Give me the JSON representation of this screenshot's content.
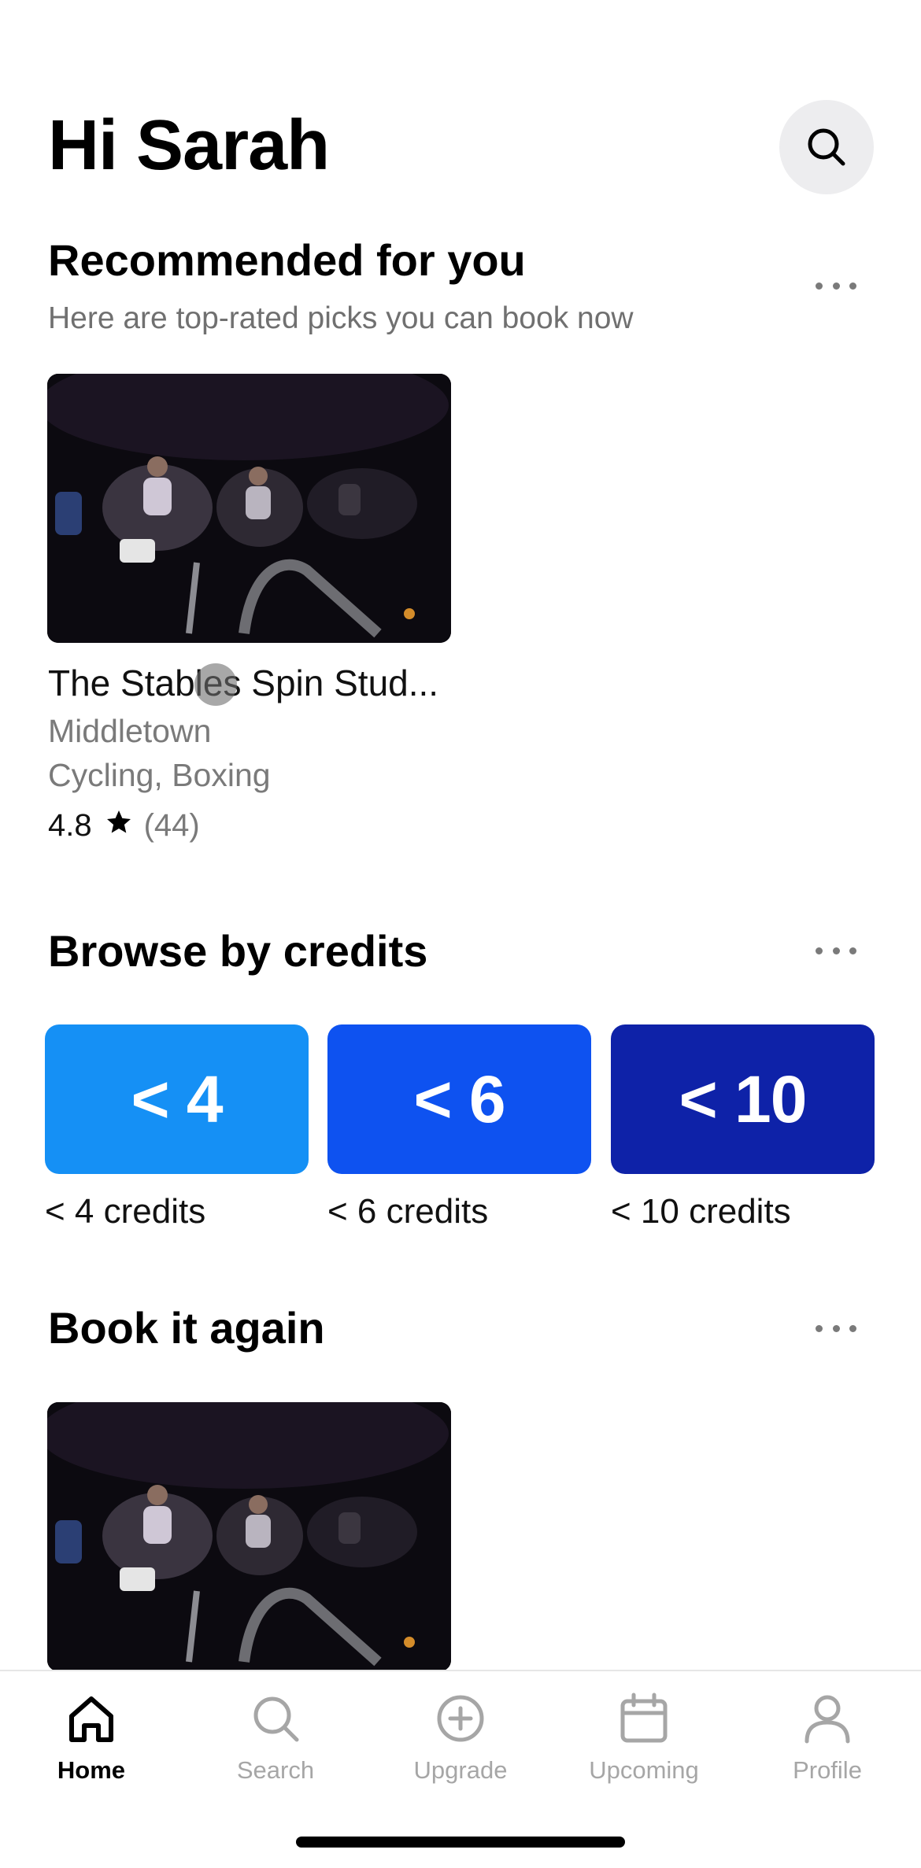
{
  "header": {
    "greeting": "Hi Sarah",
    "search_icon": "search-icon"
  },
  "recommended": {
    "title": "Recommended for you",
    "subtitle": "Here are top-rated picks you can book now",
    "card": {
      "name": "The Stables Spin Stud...",
      "location": "Middletown",
      "categories": "Cycling, Boxing",
      "rating": "4.8",
      "review_count": "(44)"
    }
  },
  "browse_credits": {
    "title": "Browse by credits",
    "tiles": [
      {
        "tile_text": "< 4",
        "label": "< 4 credits",
        "color": "#1590F5"
      },
      {
        "tile_text": "< 6",
        "label": "< 6 credits",
        "color": "#0E52F0"
      },
      {
        "tile_text": "< 10",
        "label": "< 10 credits",
        "color": "#0E22A8"
      }
    ]
  },
  "book_again": {
    "title": "Book it again"
  },
  "tab_bar": {
    "items": [
      {
        "label": "Home",
        "icon": "home-icon",
        "active": true
      },
      {
        "label": "Search",
        "icon": "search-icon",
        "active": false
      },
      {
        "label": "Upgrade",
        "icon": "plus-circle-icon",
        "active": false
      },
      {
        "label": "Upcoming",
        "icon": "calendar-icon",
        "active": false
      },
      {
        "label": "Profile",
        "icon": "person-icon",
        "active": false
      }
    ]
  }
}
